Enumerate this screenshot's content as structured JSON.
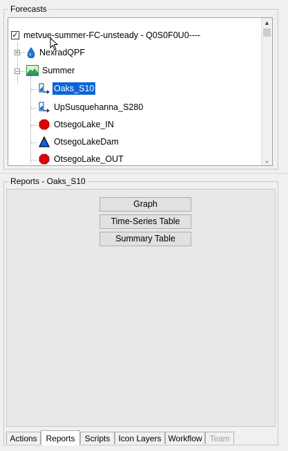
{
  "forecasts": {
    "legend": "Forecasts",
    "tree": [
      {
        "label": "metvue-summer-FC-unsteady - Q0S0F0U0----",
        "icon": "checkbox-checked-icon"
      },
      {
        "label": "NexradQPF",
        "icon": "droplet-icon"
      },
      {
        "label": "Summer",
        "icon": "landscape-icon"
      },
      {
        "label": "Oaks_S10",
        "icon": "flow-gage-icon",
        "selected": true
      },
      {
        "label": "UpSusquehanna_S280",
        "icon": "flow-gage-icon"
      },
      {
        "label": "OtsegoLake_IN",
        "icon": "red-octagon-icon"
      },
      {
        "label": "OtsegoLakeDam",
        "icon": "blue-triangle-icon"
      },
      {
        "label": "OtsegoLake_OUT",
        "icon": "red-octagon-icon"
      }
    ]
  },
  "reports": {
    "legend": "Reports - Oaks_S10",
    "buttons": [
      "Graph",
      "Time-Series Table",
      "Summary Table"
    ]
  },
  "tabs": [
    {
      "label": "Actions"
    },
    {
      "label": "Reports",
      "active": true
    },
    {
      "label": "Scripts"
    },
    {
      "label": "Icon Layers"
    },
    {
      "label": "Workflow"
    },
    {
      "label": "Team",
      "disabled": true
    }
  ],
  "colors": {
    "selection": "#0a64d6",
    "water_blue": "#1e78d8",
    "octagon_red": "#e00000",
    "triangle_blue": "#1060e0"
  }
}
